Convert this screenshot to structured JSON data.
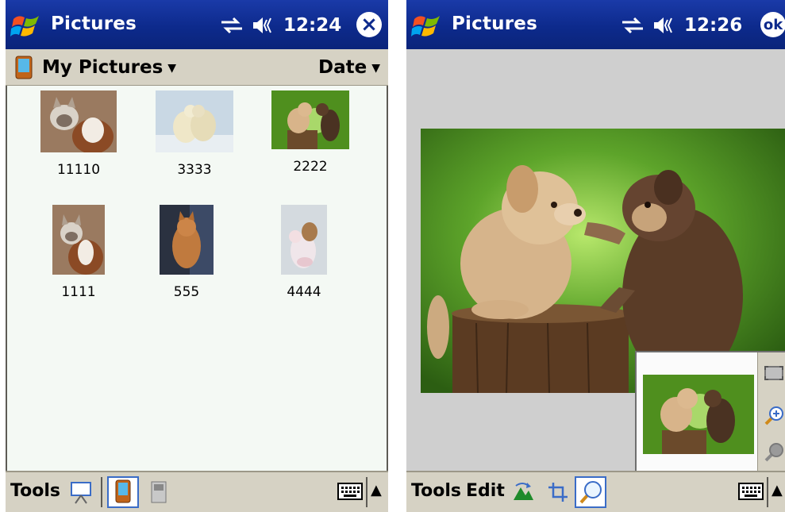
{
  "left_screen": {
    "title": "Pictures",
    "time": "12:24",
    "close_symbol": "×",
    "folder": "My Pictures",
    "sort": "Date",
    "thumbnails": [
      {
        "caption": "11110",
        "subject": "cat and dog"
      },
      {
        "caption": "3333",
        "subject": "polar bears"
      },
      {
        "caption": "2222",
        "subject": "two puppies"
      },
      {
        "caption": "1111",
        "subject": "cat and dog"
      },
      {
        "caption": "555",
        "subject": "cat"
      },
      {
        "caption": "4444",
        "subject": "kitten and puppy"
      }
    ],
    "menu": {
      "tools": "Tools"
    }
  },
  "right_screen": {
    "title": "Pictures",
    "time": "12:26",
    "ok_label": "ok",
    "menu": {
      "tools": "Tools",
      "edit": "Edit"
    }
  },
  "icons": {
    "start": "windows-flag-icon",
    "connectivity": "connectivity-arrows-icon",
    "speaker": "speaker-icon",
    "keyboard": "keyboard-icon",
    "sip_arrow": "▲",
    "caret": "▼"
  },
  "colors": {
    "titlebar": "#0d2a8c",
    "bar": "#d6d2c4",
    "list_bg": "#f4f9f4"
  }
}
